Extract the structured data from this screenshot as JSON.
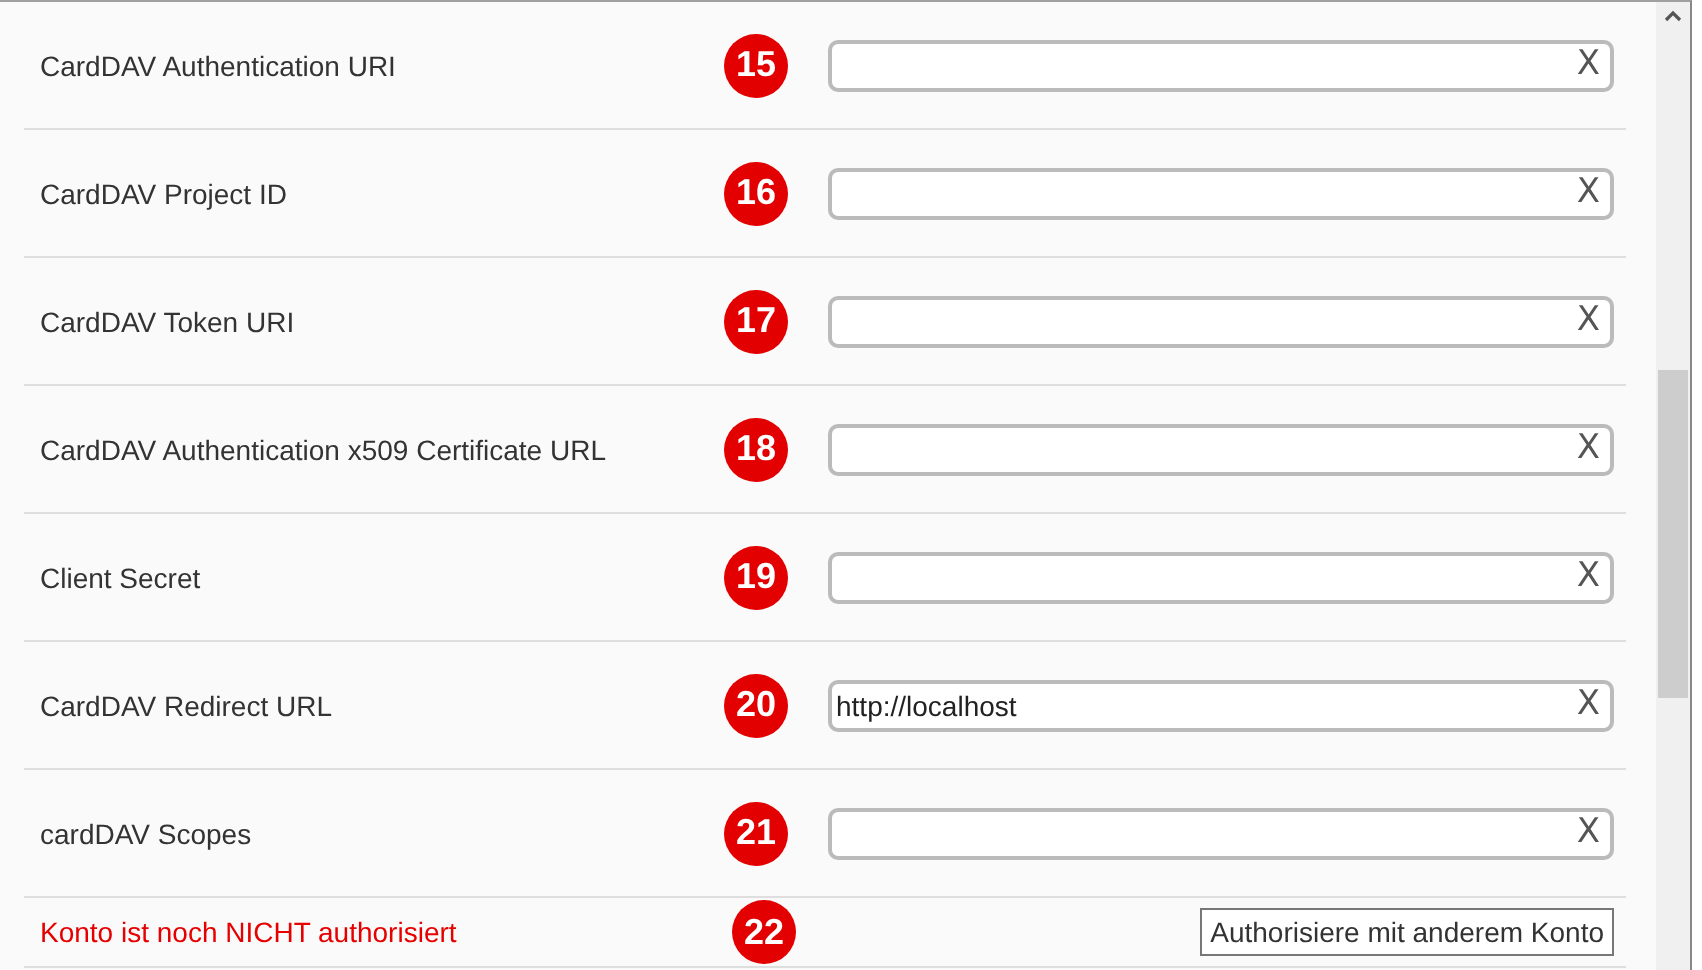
{
  "rows": [
    {
      "kind": "field",
      "label": "CardDAV Authentication URI",
      "badge": "15",
      "value": "",
      "clear": "X"
    },
    {
      "kind": "field",
      "label": "CardDAV Project ID",
      "badge": "16",
      "value": "",
      "clear": "X"
    },
    {
      "kind": "field",
      "label": "CardDAV Token URI",
      "badge": "17",
      "value": "",
      "clear": "X"
    },
    {
      "kind": "field",
      "label": "CardDAV Authentication x509 Certificate URL",
      "badge": "18",
      "value": "",
      "clear": "X"
    },
    {
      "kind": "field",
      "label": "Client Secret",
      "badge": "19",
      "value": "",
      "clear": "X"
    },
    {
      "kind": "field",
      "label": "CardDAV Redirect URL",
      "badge": "20",
      "value": "http://localhost",
      "clear": "X"
    },
    {
      "kind": "field",
      "label": "cardDAV Scopes",
      "badge": "21",
      "value": "",
      "clear": "X"
    },
    {
      "kind": "status",
      "label": "Konto ist noch NICHT authorisiert",
      "badge": "22",
      "button": "Authorisiere mit anderem Konto"
    }
  ]
}
